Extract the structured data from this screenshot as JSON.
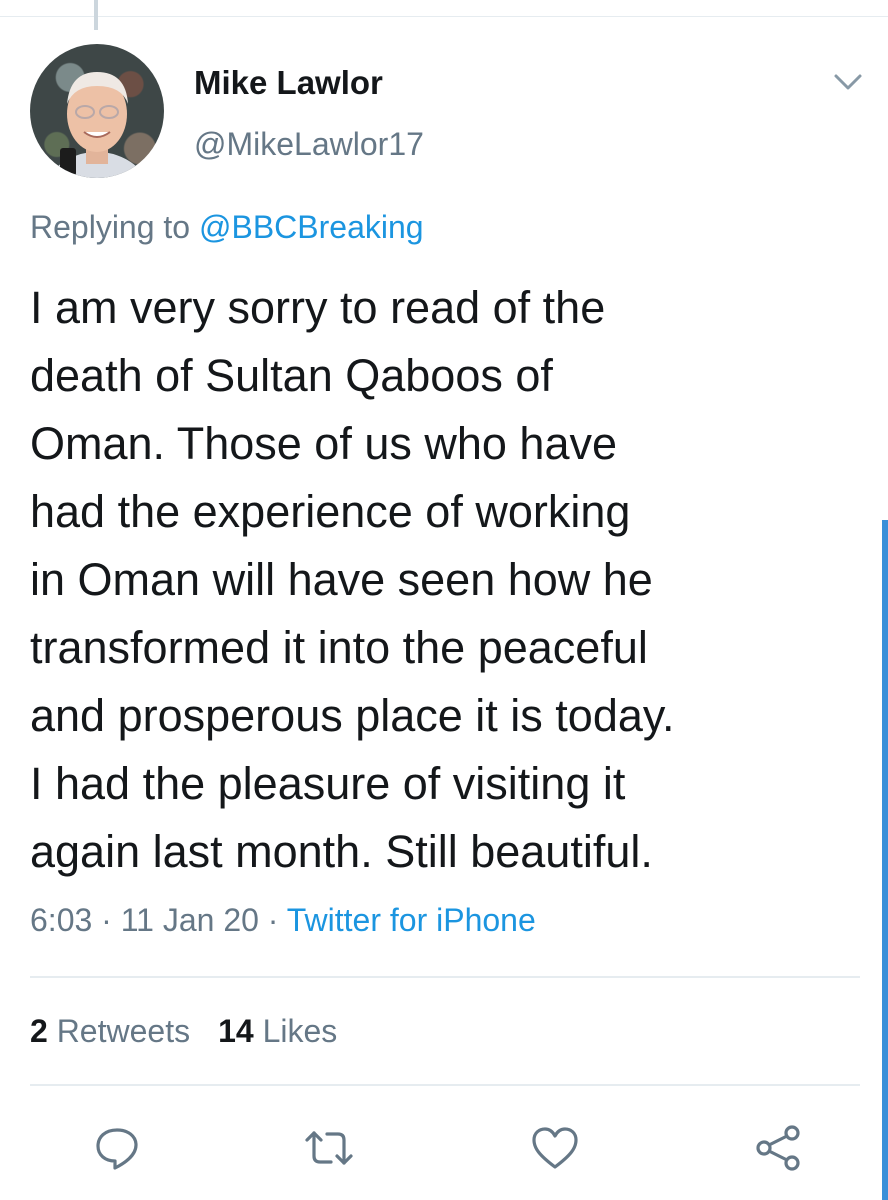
{
  "author": {
    "name": "Mike Lawlor",
    "handle": "@MikeLawlor17"
  },
  "reply": {
    "prefix": "Replying to",
    "mention": "@BBCBreaking"
  },
  "tweet": {
    "lines": [
      "I am very sorry to read of the",
      "death of Sultan Qaboos of",
      "Oman. Those of us who have",
      "had the experience of working",
      "in Oman will have seen how he",
      "transformed it into the peaceful",
      "and prosperous place it is today.",
      "I had the pleasure of visiting it",
      "again last month. Still beautiful."
    ]
  },
  "meta": {
    "time": "6:03",
    "separator": "·",
    "date": "11 Jan 20",
    "source": "Twitter for iPhone"
  },
  "stats": {
    "retweets_count": "2",
    "retweets_label": "Retweets",
    "likes_count": "14",
    "likes_label": "Likes"
  },
  "icons": {
    "menu": "chevron-down-icon",
    "reply": "reply-icon",
    "retweet": "retweet-icon",
    "like": "like-icon",
    "share": "share-icon"
  },
  "colors": {
    "accent": "#1b95e0",
    "secondary_text": "#657786",
    "primary_text": "#14171a",
    "divider": "#e6ecf0"
  }
}
